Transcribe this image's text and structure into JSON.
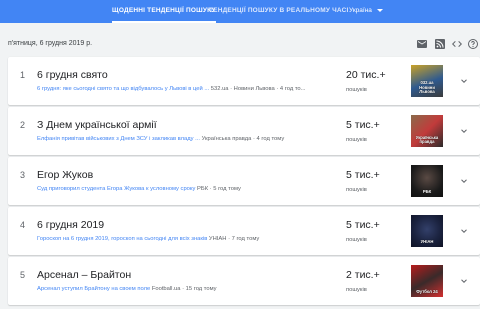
{
  "tabs": [
    {
      "label": "ЩОДЕННІ ТЕНДЕНЦІЇ ПОШУКУ",
      "active": true
    },
    {
      "label": "ТЕНДЕНЦІЇ ПОШУКУ В РЕАЛЬНОМУ ЧАСІ",
      "active": false
    }
  ],
  "country": {
    "selected": "Україна"
  },
  "date_heading": "п'ятниця, 6 грудня 2019 р.",
  "toolbar": {
    "icons": [
      "email-icon",
      "rss-icon",
      "code-embed-icon",
      "help-icon"
    ],
    "color": "#5f6368"
  },
  "colors": {
    "header": "#4285f4",
    "link": "#4285f4",
    "background": "#f1f3f4"
  },
  "trends": [
    {
      "rank": "1",
      "title": "6 грудня свято",
      "article": "6 грудня: яке сьогодні свято та що відбувалось у Львові в цей ...",
      "source": "532.ua · Новини Львова · 4 год то...",
      "count": "20 тис.+",
      "count_label": "пошуків",
      "thumb_caption": "032.ua\nНовини\nЛьвова",
      "thumb_colors": [
        "#c9a227",
        "#2f5a8f",
        "#3b3b3b"
      ]
    },
    {
      "rank": "2",
      "title": "З Днем української армії",
      "article": "Елфанія привітав військових з Днем ЗСУ і закликав владу ...",
      "source": "Українська правда · 4 год тому",
      "count": "5 тис.+",
      "count_label": "пошуків",
      "thumb_caption": "Українська\nправда",
      "thumb_colors": [
        "#8a6a4a",
        "#c23b3b",
        "#2a2a2a"
      ]
    },
    {
      "rank": "3",
      "title": "Егор Жуков",
      "article": "Суд приговорил студента Егора Жукова к условному сроку",
      "source": "РБК · 5 год тому",
      "count": "5 тис.+",
      "count_label": "пошуків",
      "thumb_caption": "РБК",
      "thumb_colors": [
        "#1a1a1a",
        "#3a3030",
        "#101010"
      ]
    },
    {
      "rank": "4",
      "title": "6 грудня 2019",
      "article": "Гороскоп на 6 грудня 2019, гороскоп на сьогодні для всіх знаків",
      "source": "УНІАН · 7 год тому",
      "count": "5 тис.+",
      "count_label": "пошуків",
      "thumb_caption": "УНІАН",
      "thumb_colors": [
        "#1b2340",
        "#33406a",
        "#0e1224"
      ]
    },
    {
      "rank": "5",
      "title": "Арсенал – Брайтон",
      "article": "Арсенал уступил Брайтону на своем поле",
      "source": "Football.ua · 15 год тому",
      "count": "2 тис.+",
      "count_label": "пошуків",
      "thumb_caption": "Футбол 24",
      "thumb_colors": [
        "#b71c1c",
        "#3a2a2a",
        "#d32f2f"
      ]
    }
  ]
}
